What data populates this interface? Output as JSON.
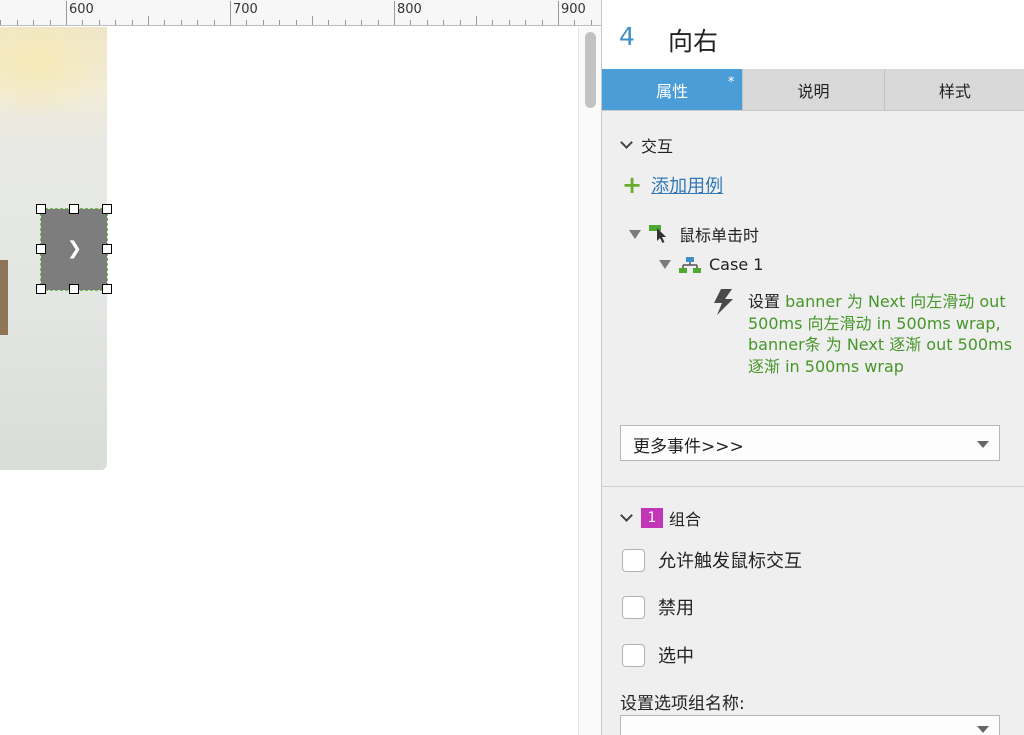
{
  "ruler": {
    "labels": [
      "600",
      "700",
      "800",
      "900"
    ]
  },
  "widget": {
    "icon": "chevron-right-icon",
    "arrow_glyph": "❯"
  },
  "panel": {
    "number": "4",
    "title": "向右",
    "tabs": [
      {
        "label": "属性",
        "active": true,
        "marker": "*"
      },
      {
        "label": "说明",
        "active": false
      },
      {
        "label": "样式",
        "active": false
      }
    ],
    "interaction": {
      "section_label": "交互",
      "add_case_label": "添加用例",
      "event_label": "鼠标单击时",
      "case_label": "Case 1",
      "action_lead": "设置",
      "action_detail": " banner  为 Next 向左滑动 out 500ms 向左滑动 in 500ms wrap,\nbanner条 为 Next 逐渐 out 500ms 逐渐 in 500ms wrap",
      "more_events_label": "更多事件>>>"
    },
    "group": {
      "badge": "1",
      "section_label": "组合",
      "options": [
        {
          "label": "允许触发鼠标交互",
          "checked": false
        },
        {
          "label": "禁用",
          "checked": false
        },
        {
          "label": "选中",
          "checked": false
        }
      ],
      "group_name_label": "设置选项组名称:",
      "group_name_value": ""
    }
  },
  "colors": {
    "accent": "#4b9dd8",
    "link": "#3479b7",
    "action_green": "#47962a",
    "badge_magenta": "#c235b6",
    "title_number": "#3e8ec9"
  }
}
